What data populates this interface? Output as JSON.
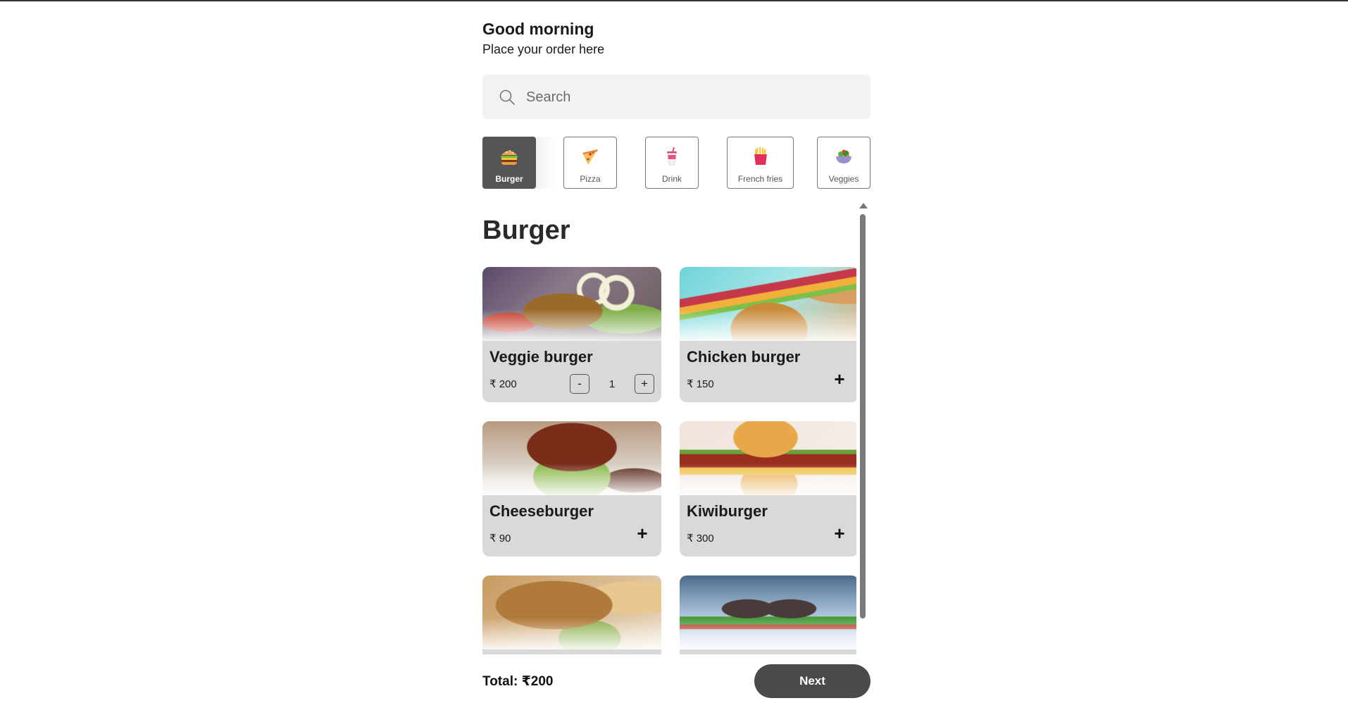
{
  "header": {
    "greeting": "Good morning",
    "subtitle": "Place your order here"
  },
  "search": {
    "placeholder": "Search",
    "value": ""
  },
  "categories": [
    {
      "label": "Burger",
      "icon": "burger-icon",
      "active": true
    },
    {
      "label": "Pizza",
      "icon": "pizza-icon",
      "active": false
    },
    {
      "label": "Drink",
      "icon": "drink-icon",
      "active": false
    },
    {
      "label": "French fries",
      "icon": "french-fries-icon",
      "active": false
    },
    {
      "label": "Veggies",
      "icon": "veggies-icon",
      "active": false
    }
  ],
  "section": {
    "title": "Burger"
  },
  "items": [
    {
      "name": "Veggie burger",
      "price": "₹ 200",
      "quantity": "1",
      "in_cart": true,
      "image": "veggie-burger-photo"
    },
    {
      "name": "Chicken burger",
      "price": "₹ 150",
      "in_cart": false,
      "image": "chicken-burger-photo"
    },
    {
      "name": "Cheeseburger",
      "price": "₹ 90",
      "in_cart": false,
      "image": "cheeseburger-photo"
    },
    {
      "name": "Kiwiburger",
      "price": "₹ 300",
      "in_cart": false,
      "image": "kiwiburger-photo"
    },
    {
      "name": "",
      "price": "",
      "in_cart": false,
      "image": "patty-burger-photo"
    },
    {
      "name": "",
      "price": "",
      "in_cart": false,
      "image": "dark-bun-burgers-photo"
    }
  ],
  "stepper": {
    "minus": "-",
    "plus": "+"
  },
  "add_symbol": "+",
  "footer": {
    "total": "Total: ₹200",
    "next": "Next"
  },
  "colors": {
    "accent": "#555555",
    "search_bg": "#f1f3f2",
    "card_bg": "#d9d9d9",
    "next_button": "#4a4a4a"
  }
}
